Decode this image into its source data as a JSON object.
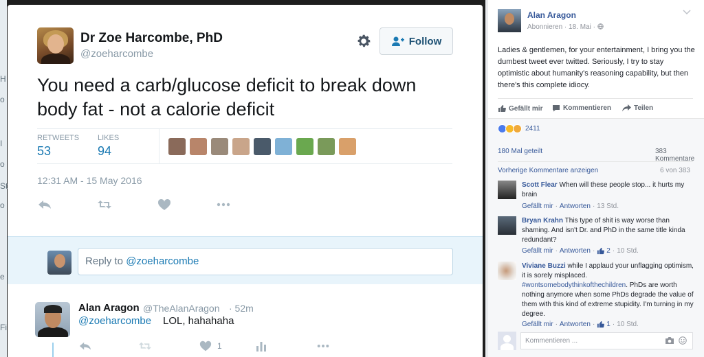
{
  "left_strip": {
    "letters": [
      "H",
      "o",
      "I",
      "o",
      "St",
      "o",
      "e",
      "Fi"
    ]
  },
  "tweet": {
    "author_name": "Dr Zoe Harcombe, PhD",
    "author_handle": "@zoeharcombe",
    "follow_label": "Follow",
    "text": "You need a carb/glucose deficit to break down body fat - not a calorie deficit",
    "retweets_label": "RETWEETS",
    "retweets_count": "53",
    "likes_label": "LIKES",
    "likes_count": "94",
    "timestamp": "12:31 AM - 15 May 2016",
    "likers": [
      "#8a6a5a",
      "#b8856a",
      "#9a8a7a",
      "#c9a58a",
      "#4a5a6a",
      "#7fb1d6",
      "#6aa84f",
      "#7a9a5a",
      "#d9a06a"
    ],
    "icons": [
      "gear-icon",
      "add-user-icon",
      "reply-icon",
      "retweet-icon",
      "heart-icon",
      "more-icon"
    ]
  },
  "reply_box": {
    "prefix": "Reply to ",
    "mention": "@zoeharcombe"
  },
  "reply_tweet": {
    "author_name": "Alan Aragon",
    "author_handle": "@TheAlanAragon",
    "time": "· 52m",
    "mention": "@zoeharcombe",
    "text": "LOL, hahahaha",
    "like_count": "1"
  },
  "facebook": {
    "author": "Alan Aragon",
    "meta": "Abonnieren · 18. Mai · ",
    "post_text": "Ladies & gentlemen, for your entertainment, I bring you the dumbest tweet ever twitted. Seriously, I try to stay optimistic about humanity's reasoning capability, but then there's this complete idiocy.",
    "actions": {
      "like": "Gefällt mir",
      "comment": "Kommentieren",
      "share": "Teilen"
    },
    "reaction_count": "2411",
    "shares": "180 Mal geteilt",
    "comment_count": "383 Kommentare",
    "previous_comments": "Vorherige Kommentare anzeigen",
    "previous_count": "6 von 383",
    "comments": [
      {
        "name": "Scott Flear",
        "text": " When will these people stop... it hurts my brain",
        "like": "Gefällt mir",
        "reply": "Antworten",
        "likes": "",
        "time": "13 Std."
      },
      {
        "name": "Bryan Krahn",
        "text": " This type of shit is way worse than shaming. And isn't Dr. and PhD in the same title kinda redundant?",
        "like": "Gefällt mir",
        "reply": "Antworten",
        "likes": "2",
        "time": "10 Std."
      },
      {
        "name": "Viviane Buzzi",
        "text_before": " while I applaud your unflagging optimism, it is sorely misplaced. ",
        "hashtag": "#wontsomebodythinkofthechildren",
        "text_after": ". PhDs are worth nothing anymore when some PhDs degrade the value of them with this kind of extreme stupidity. I'm turning in my degree.",
        "like": "Gefällt mir",
        "reply": "Antworten",
        "likes": "1",
        "time": "10 Std."
      }
    ],
    "write_placeholder": "Kommentieren ..."
  },
  "colors": {
    "twitter_blue": "#1b7ab3",
    "facebook_blue": "#365899",
    "reply_bar": "#e8f4fb"
  }
}
